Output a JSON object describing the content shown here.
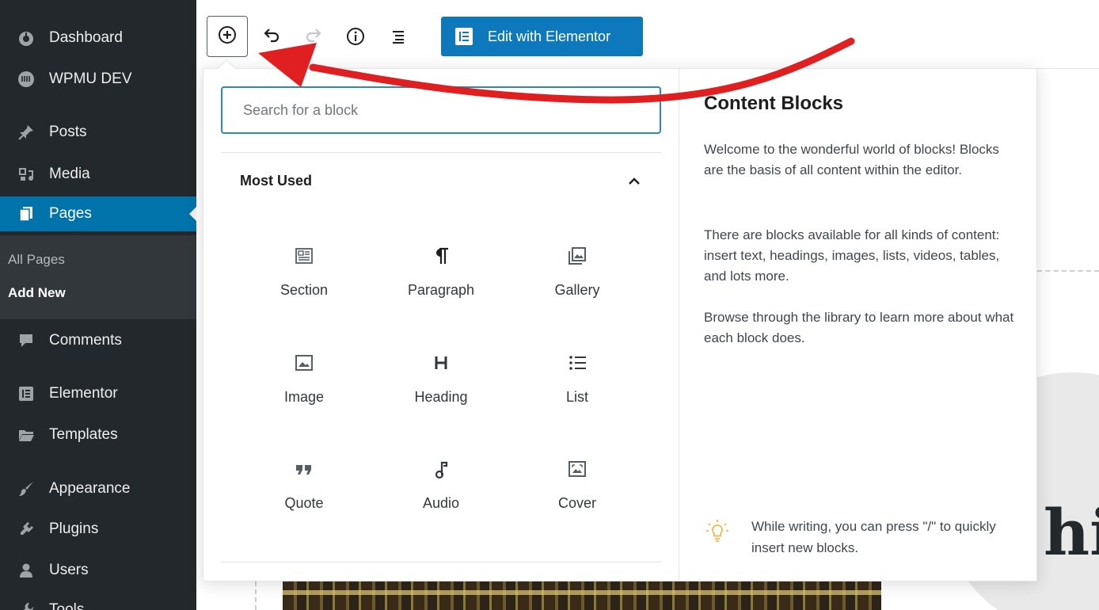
{
  "sidebar": {
    "items": [
      {
        "label": "Dashboard",
        "icon": "dashboard-icon"
      },
      {
        "label": "WPMU DEV",
        "icon": "wpmudev-icon"
      },
      {
        "label": "Posts",
        "icon": "pin-icon"
      },
      {
        "label": "Media",
        "icon": "media-icon"
      },
      {
        "label": "Pages",
        "icon": "pages-icon"
      },
      {
        "label": "Comments",
        "icon": "comment-icon"
      },
      {
        "label": "Elementor",
        "icon": "elementor-icon"
      },
      {
        "label": "Templates",
        "icon": "folder-icon"
      },
      {
        "label": "Appearance",
        "icon": "brush-icon"
      },
      {
        "label": "Plugins",
        "icon": "plugin-icon"
      },
      {
        "label": "Users",
        "icon": "user-icon"
      },
      {
        "label": "Tools",
        "icon": "wrench-icon"
      }
    ],
    "submenu": [
      "All Pages",
      "Add New"
    ]
  },
  "toolbar": {
    "elementor_label": "Edit with Elementor"
  },
  "inserter": {
    "search_placeholder": "Search for a block",
    "section_title": "Most Used",
    "blocks": [
      {
        "label": "Section",
        "icon": "section-icon"
      },
      {
        "label": "Paragraph",
        "icon": "paragraph-icon"
      },
      {
        "label": "Gallery",
        "icon": "gallery-icon"
      },
      {
        "label": "Image",
        "icon": "image-icon"
      },
      {
        "label": "Heading",
        "icon": "heading-icon"
      },
      {
        "label": "List",
        "icon": "list-icon"
      },
      {
        "label": "Quote",
        "icon": "quote-icon"
      },
      {
        "label": "Audio",
        "icon": "audio-icon"
      },
      {
        "label": "Cover",
        "icon": "cover-icon"
      }
    ]
  },
  "panel": {
    "title": "Content Blocks",
    "paragraphs": [
      "Welcome to the wonderful world of blocks! Blocks are the basis of all content within the editor.",
      "There are blocks available for all kinds of content: insert text, headings, images, lists, videos, tables, and lots more.",
      "Browse through the library to learn more about what each block does."
    ],
    "tip": "While writing, you can press \"/\" to quickly insert new blocks."
  },
  "background": {
    "heading_fragment": "hi"
  },
  "colors": {
    "sidebar_bg": "#23282d",
    "active": "#0073aa",
    "elementor": "#0d78bb",
    "arrow": "#e02020"
  }
}
